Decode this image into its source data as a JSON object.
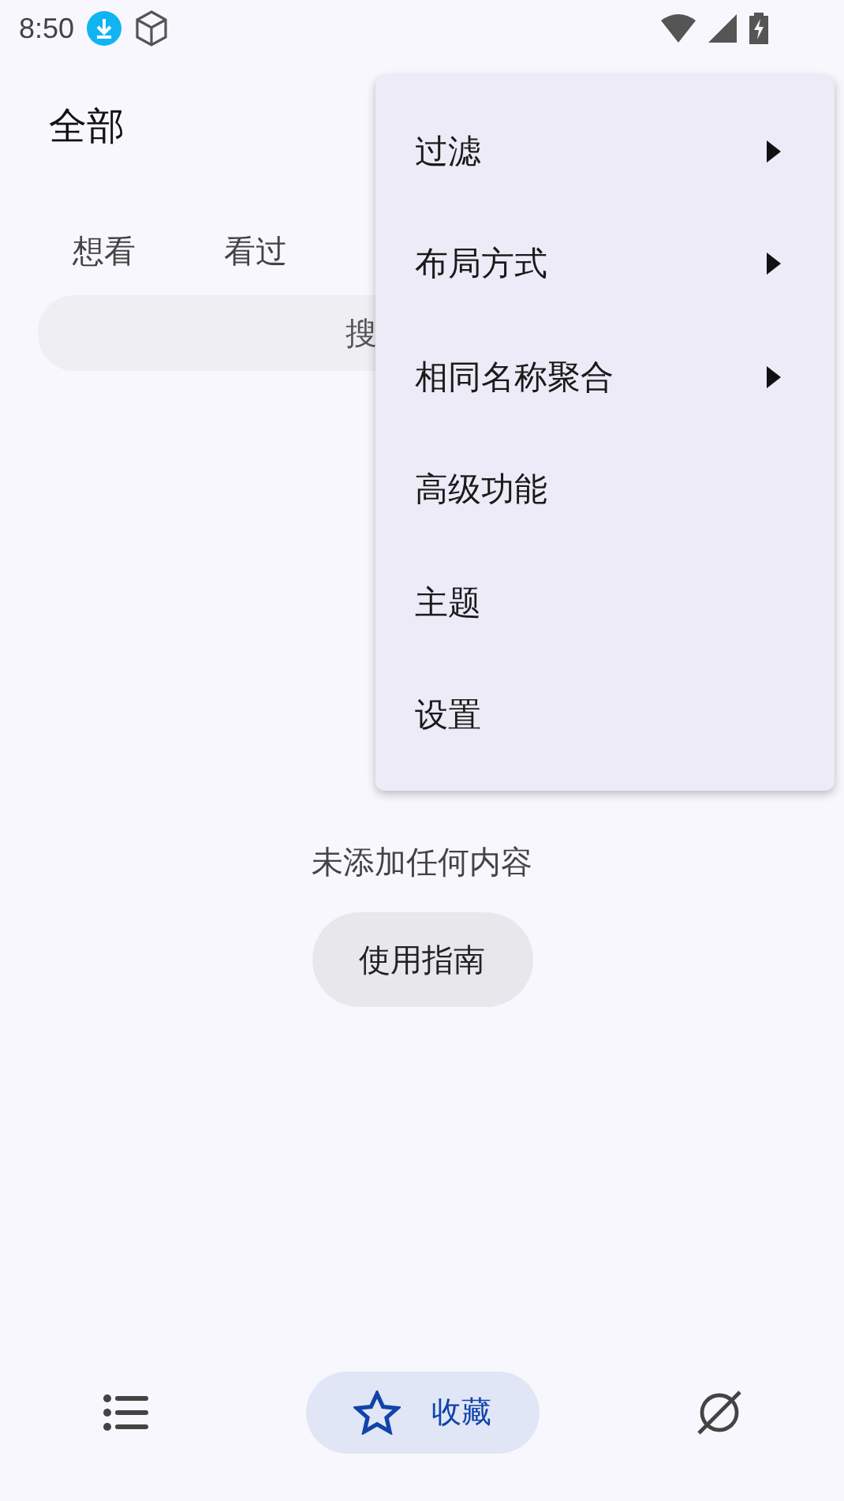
{
  "status_bar": {
    "time": "8:50"
  },
  "header": {
    "title": "全部"
  },
  "tabs": [
    {
      "label": "想看"
    },
    {
      "label": "看过"
    }
  ],
  "search": {
    "placeholder": "搜"
  },
  "empty_state": {
    "message": "未添加任何内容",
    "button": "使用指南"
  },
  "menu": [
    {
      "label": "过滤",
      "submenu": true
    },
    {
      "label": "布局方式",
      "submenu": true
    },
    {
      "label": "相同名称聚合",
      "submenu": true
    },
    {
      "label": "高级功能",
      "submenu": false
    },
    {
      "label": "主题",
      "submenu": false
    },
    {
      "label": "设置",
      "submenu": false
    }
  ],
  "bottom_nav": [
    {
      "kind": "list",
      "selected": false
    },
    {
      "kind": "star",
      "label": "收藏",
      "selected": true
    },
    {
      "kind": "planet",
      "selected": false
    }
  ]
}
